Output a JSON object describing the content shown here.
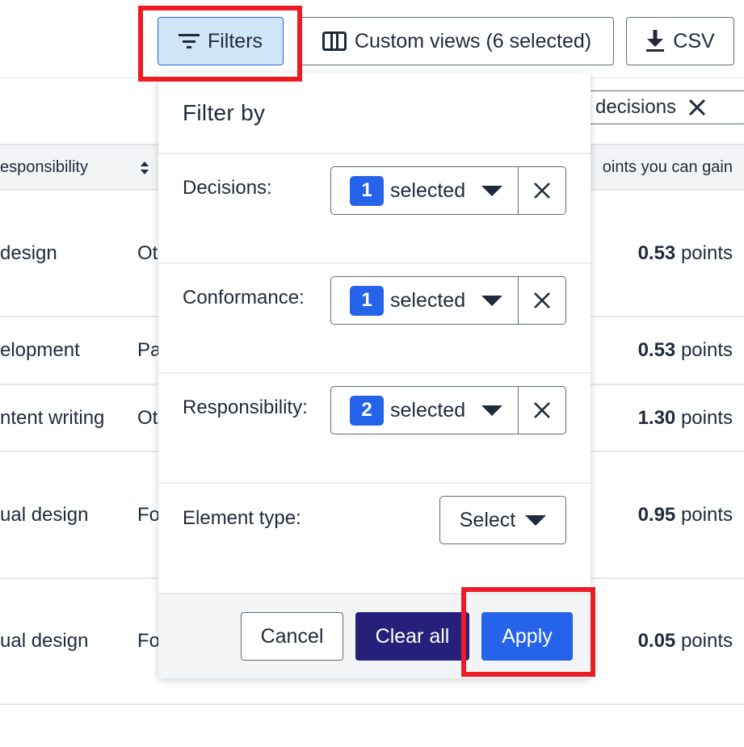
{
  "toolbar": {
    "filters_label": "Filters",
    "custom_views_label": "Custom views (6 selected)",
    "csv_label": "CSV"
  },
  "active_chip": {
    "label": "decisions"
  },
  "table": {
    "headers": {
      "responsibility": "esponsibility",
      "points": "oints you can gain"
    },
    "rows": [
      {
        "responsibility": "design",
        "col2": "Ot",
        "points_value": "0.53",
        "points_unit": "points"
      },
      {
        "responsibility": "elopment",
        "col2": "Pa",
        "points_value": "0.53",
        "points_unit": "points"
      },
      {
        "responsibility": "ntent writing",
        "col2": "Ot",
        "points_value": "1.30",
        "points_unit": "points"
      },
      {
        "responsibility": "ual design",
        "col2": "Fo",
        "points_value": "0.95",
        "points_unit": "points"
      },
      {
        "responsibility": "ual design",
        "col2": "Fo",
        "points_value": "0.05",
        "points_unit": "points"
      }
    ]
  },
  "filter_panel": {
    "title": "Filter by",
    "filters": [
      {
        "label": "Decisions:",
        "count": "1",
        "text": "selected"
      },
      {
        "label": "Conformance:",
        "count": "1",
        "text": "selected"
      },
      {
        "label": "Responsibility:",
        "count": "2",
        "text": "selected"
      }
    ],
    "element_type": {
      "label": "Element type:",
      "value": "Select"
    },
    "buttons": {
      "cancel": "Cancel",
      "clear_all": "Clear all",
      "apply": "Apply"
    }
  },
  "colors": {
    "primary": "#2563eb",
    "clear_all": "#27207a",
    "highlight": "#ed1c24",
    "filters_active_bg": "#cfe6f8"
  }
}
